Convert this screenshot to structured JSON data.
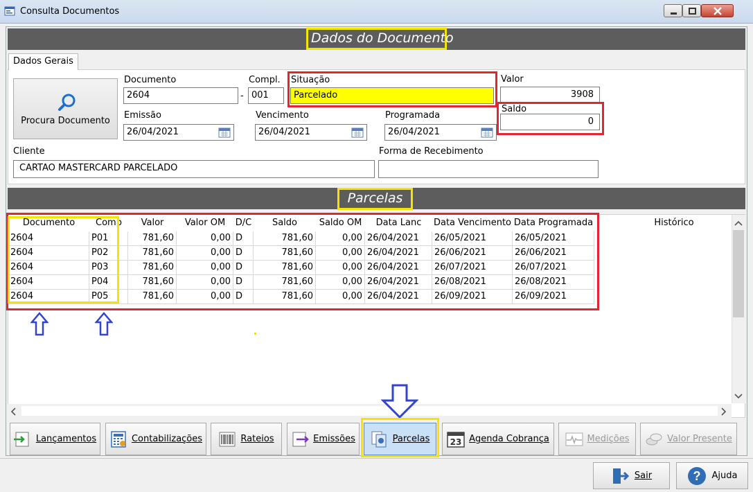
{
  "window": {
    "title": "Consulta Documentos"
  },
  "sections": {
    "document": "Dados do Documento",
    "installments": "Parcelas"
  },
  "tabs": [
    "Dados Gerais"
  ],
  "search_button": "Procura Documento",
  "form": {
    "documento": {
      "label": "Documento",
      "value": "2604"
    },
    "dash": "-",
    "compl": {
      "label": "Compl.",
      "value": "001"
    },
    "situacao": {
      "label": "Situação",
      "value": "Parcelado"
    },
    "valor": {
      "label": "Valor",
      "value": "3908"
    },
    "saldo": {
      "label": "Saldo",
      "value": "0"
    },
    "emissao": {
      "label": "Emissão",
      "value": "26/04/2021"
    },
    "vencimento": {
      "label": "Vencimento",
      "value": "26/04/2021"
    },
    "programada": {
      "label": "Programada",
      "value": "26/04/2021"
    },
    "cliente": {
      "label": "Cliente",
      "value": "CARTAO MASTERCARD PARCELADO"
    },
    "forma_recebimento": {
      "label": "Forma de Recebimento",
      "value": ""
    }
  },
  "grid": {
    "columns": [
      "Documento",
      "Comp",
      "Valor",
      "Valor OM",
      "D/C",
      "Saldo",
      "Saldo OM",
      "Data Lanc",
      "Data Vencimento",
      "Data Programada",
      "Histórico"
    ],
    "rows": [
      [
        "2604",
        "P01",
        "781,60",
        "0,00",
        "D",
        "781,60",
        "0,00",
        "26/04/2021",
        "26/05/2021",
        "26/05/2021",
        ""
      ],
      [
        "2604",
        "P02",
        "781,60",
        "0,00",
        "D",
        "781,60",
        "0,00",
        "26/04/2021",
        "26/06/2021",
        "26/06/2021",
        ""
      ],
      [
        "2604",
        "P03",
        "781,60",
        "0,00",
        "D",
        "781,60",
        "0,00",
        "26/04/2021",
        "26/07/2021",
        "26/07/2021",
        ""
      ],
      [
        "2604",
        "P04",
        "781,60",
        "0,00",
        "D",
        "781,60",
        "0,00",
        "26/04/2021",
        "26/08/2021",
        "26/08/2021",
        ""
      ],
      [
        "2604",
        "P05",
        "781,60",
        "0,00",
        "D",
        "781,60",
        "0,00",
        "26/04/2021",
        "26/09/2021",
        "26/09/2021",
        ""
      ]
    ]
  },
  "toolbar": [
    {
      "label": "Lançamentos",
      "icon": "arrow-in-icon",
      "enabled": true,
      "active": false
    },
    {
      "label": "Contabilizações",
      "icon": "calculator-icon",
      "enabled": true,
      "active": false
    },
    {
      "label": "Rateios",
      "icon": "barcode-icon",
      "enabled": true,
      "active": false
    },
    {
      "label": "Emissões",
      "icon": "arrow-out-icon",
      "enabled": true,
      "active": false
    },
    {
      "label": "Parcelas",
      "icon": "documents-icon",
      "enabled": true,
      "active": true
    },
    {
      "label": "Agenda Cobrança",
      "icon": "calendar-23-icon",
      "enabled": true,
      "active": false
    },
    {
      "label": "Medições",
      "icon": "pulse-icon",
      "enabled": false,
      "active": false
    },
    {
      "label": "Valor Presente",
      "icon": "coins-icon",
      "enabled": false,
      "active": false
    }
  ],
  "bottom": {
    "sair": "Sair",
    "ajuda": "Ajuda"
  },
  "colors": {
    "highlight_red": "#e2252e",
    "highlight_yellow": "#f5e400",
    "arrow_blue": "#3344cc",
    "section_bar": "#5d5d5d",
    "situacao_bg": "#ffff00"
  }
}
